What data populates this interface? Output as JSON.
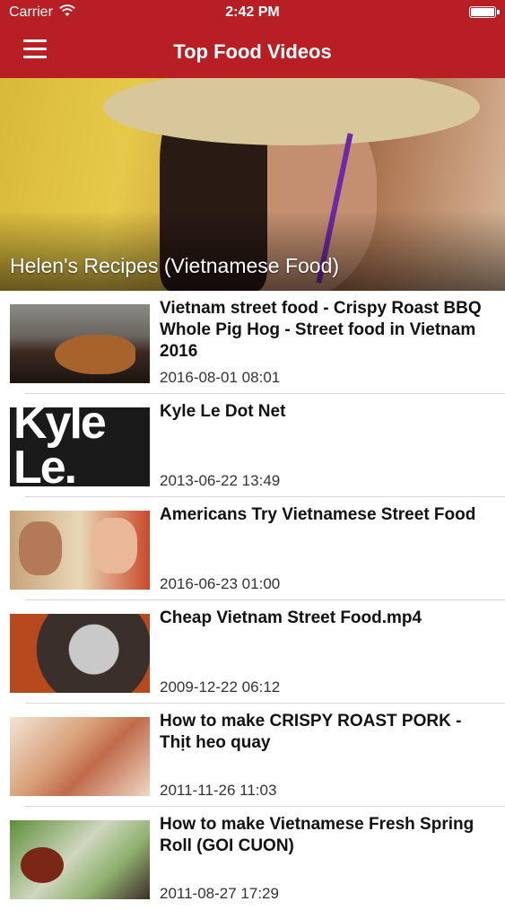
{
  "status_bar": {
    "carrier": "Carrier",
    "time": "2:42 PM"
  },
  "nav": {
    "title": "Top Food Videos",
    "menu_icon": "hamburger-menu-icon"
  },
  "hero": {
    "channel_title": "Helen's Recipes (Vietnamese Food)"
  },
  "thumb_texts": {
    "kyle_le": "Kyle Le."
  },
  "videos": [
    {
      "title": "Vietnam street food - Crispy Roast BBQ Whole Pig Hog - Street food in Vietnam 2016",
      "date": "2016-08-01 08:01"
    },
    {
      "title": "Kyle Le Dot Net",
      "date": "2013-06-22 13:49"
    },
    {
      "title": "Americans Try Vietnamese Street Food",
      "date": "2016-06-23 01:00"
    },
    {
      "title": "Cheap Vietnam Street Food.mp4",
      "date": "2009-12-22 06:12"
    },
    {
      "title": "How to make CRISPY ROAST PORK - Thịt heo quay",
      "date": "2011-11-26 11:03"
    },
    {
      "title": "How to make Vietnamese Fresh Spring Roll (GOI CUON)",
      "date": "2011-08-27 17:29"
    }
  ],
  "colors": {
    "nav_bar": "#b71f24",
    "text_primary": "#111111",
    "separator": "#d8d8d8"
  }
}
